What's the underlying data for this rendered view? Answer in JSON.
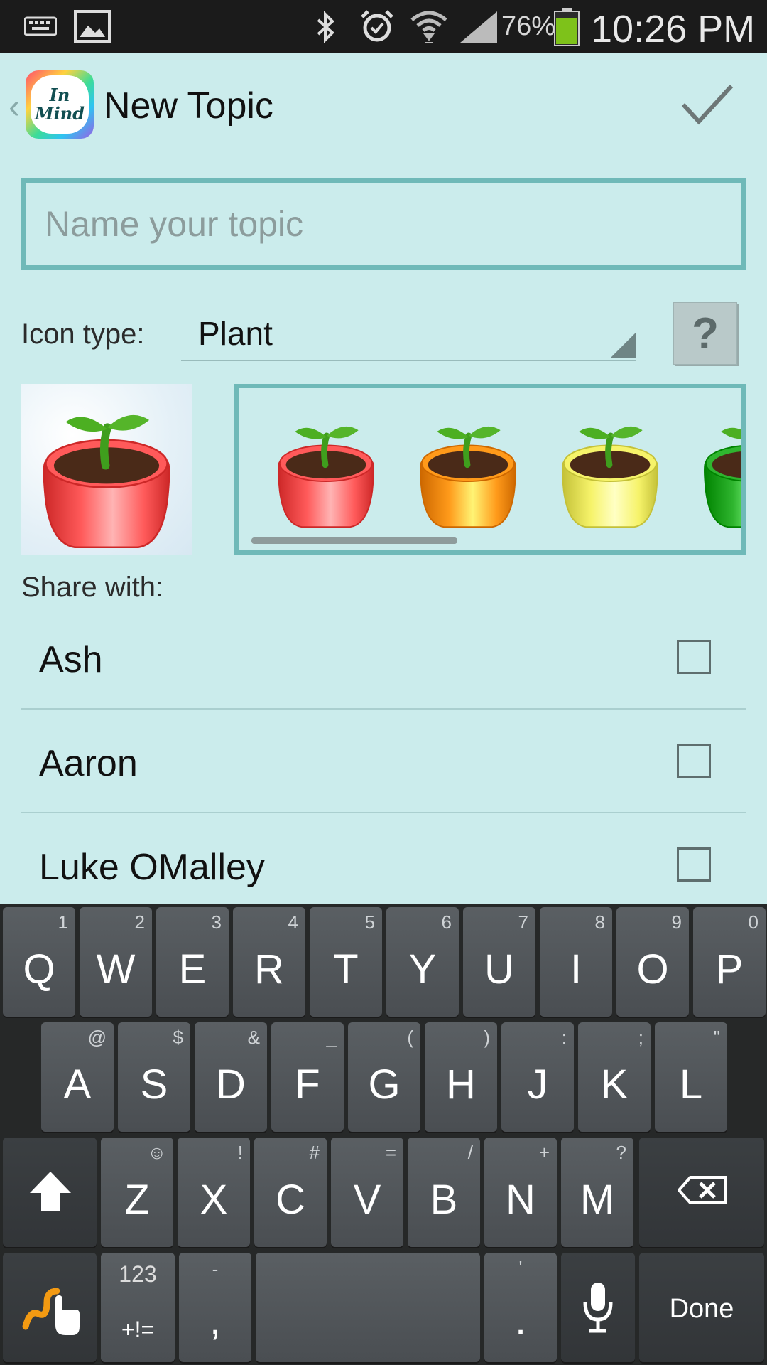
{
  "status_bar": {
    "battery_percent": "76%",
    "time": "10:26 PM",
    "icons": [
      "keyboard-icon",
      "image-icon",
      "bluetooth-icon",
      "alarm-icon",
      "wifi-icon",
      "signal-icon",
      "battery-icon"
    ]
  },
  "action_bar": {
    "logo_line1": "In",
    "logo_line2": "Mind",
    "title": "New Topic",
    "confirm_icon": "check-icon"
  },
  "form": {
    "name_placeholder": "Name your topic",
    "name_value": "",
    "icon_type_label": "Icon type:",
    "icon_type_value": "Plant",
    "help_label": "?",
    "preview_color": "#ff5a5a",
    "picker_options": [
      {
        "color": "#ff5a5a"
      },
      {
        "color": "#ff9a1a"
      },
      {
        "color": "#f6f36a"
      },
      {
        "color": "#2fb52f"
      }
    ],
    "share_label": "Share with:",
    "contacts": [
      {
        "name": "Ash",
        "checked": false
      },
      {
        "name": "Aaron",
        "checked": false
      },
      {
        "name": "Luke OMalley",
        "checked": false
      }
    ]
  },
  "keyboard": {
    "row1": [
      {
        "k": "Q",
        "a": "1"
      },
      {
        "k": "W",
        "a": "2"
      },
      {
        "k": "E",
        "a": "3"
      },
      {
        "k": "R",
        "a": "4"
      },
      {
        "k": "T",
        "a": "5"
      },
      {
        "k": "Y",
        "a": "6"
      },
      {
        "k": "U",
        "a": "7"
      },
      {
        "k": "I",
        "a": "8"
      },
      {
        "k": "O",
        "a": "9"
      },
      {
        "k": "P",
        "a": "0"
      }
    ],
    "row2": [
      {
        "k": "A",
        "a": "@"
      },
      {
        "k": "S",
        "a": "$"
      },
      {
        "k": "D",
        "a": "&"
      },
      {
        "k": "F",
        "a": "_"
      },
      {
        "k": "G",
        "a": "("
      },
      {
        "k": "H",
        "a": ")"
      },
      {
        "k": "J",
        "a": ":"
      },
      {
        "k": "K",
        "a": ";"
      },
      {
        "k": "L",
        "a": "\""
      }
    ],
    "row3": [
      {
        "k": "Z",
        "a": "☺"
      },
      {
        "k": "X",
        "a": "!"
      },
      {
        "k": "C",
        "a": "#"
      },
      {
        "k": "V",
        "a": "="
      },
      {
        "k": "B",
        "a": "/"
      },
      {
        "k": "N",
        "a": "+"
      },
      {
        "k": "M",
        "a": "?"
      }
    ],
    "numbers_top": "123",
    "numbers_bottom": "+!=",
    "comma": ",",
    "comma_alt": "-",
    "period": ".",
    "period_alt": "'",
    "done": "Done"
  }
}
